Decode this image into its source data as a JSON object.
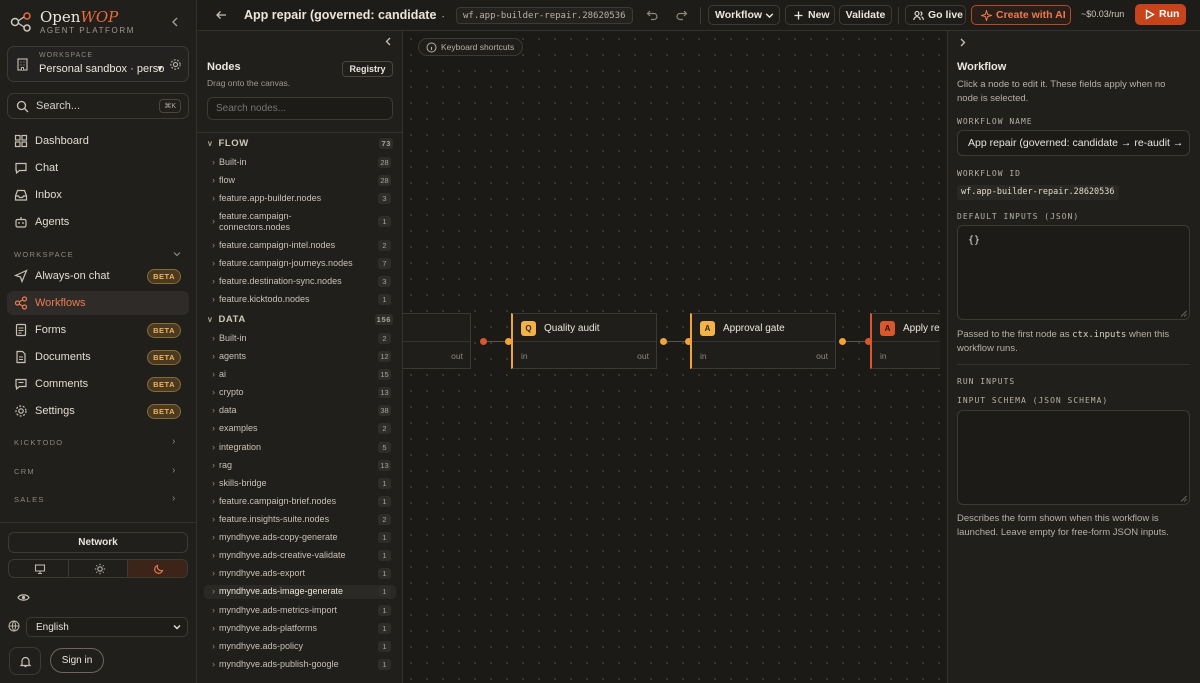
{
  "brand": {
    "name_part1": "Open",
    "name_part2": "WOP",
    "subtitle": "AGENT PLATFORM"
  },
  "workspace": {
    "label": "WORKSPACE",
    "value": "Personal sandbox · personal"
  },
  "search": {
    "placeholder": "Search...",
    "shortcut": "⌘K"
  },
  "nav_primary": [
    {
      "label": "Dashboard",
      "icon": "grid-icon"
    },
    {
      "label": "Chat",
      "icon": "chat-bubble-icon"
    },
    {
      "label": "Inbox",
      "icon": "inbox-icon"
    },
    {
      "label": "Agents",
      "icon": "robot-icon"
    }
  ],
  "workspace_section": {
    "label": "WORKSPACE"
  },
  "nav_workspace": [
    {
      "label": "Always-on chat",
      "icon": "send-icon",
      "badge": "BETA"
    },
    {
      "label": "Workflows",
      "icon": "workflow-icon",
      "badge": "",
      "active": true
    },
    {
      "label": "Forms",
      "icon": "form-icon",
      "badge": "BETA"
    },
    {
      "label": "Documents",
      "icon": "document-icon",
      "badge": "BETA"
    },
    {
      "label": "Comments",
      "icon": "comment-icon",
      "badge": "BETA"
    },
    {
      "label": "Settings",
      "icon": "gear-icon",
      "badge": "BETA"
    }
  ],
  "sections": [
    "KICKTODO",
    "CRM",
    "SALES"
  ],
  "network_label": "Network",
  "theme_options": [
    "desktop-icon",
    "sun-icon",
    "moon-icon"
  ],
  "language": "English",
  "signin_label": "Sign in",
  "topbar": {
    "title": "App repair (governed: candidate → r...",
    "workflow_id": "wf.app-builder-repair.28620536",
    "workflow_menu": "Workflow",
    "new_label": "New",
    "validate_label": "Validate",
    "golive_label": "Go live",
    "create_ai_label": "Create with AI",
    "cost": "~$0.03/run",
    "run_label": "Run"
  },
  "nodes_panel": {
    "title": "Nodes",
    "subtitle": "Drag onto the canvas.",
    "registry_label": "Registry",
    "search_placeholder": "Search nodes...",
    "categories": [
      {
        "name": "FLOW",
        "count": "73",
        "items": [
          {
            "label": "Built-in",
            "count": "28"
          },
          {
            "label": "flow",
            "count": "28"
          },
          {
            "label": "feature.app-builder.nodes",
            "count": "3"
          },
          {
            "label": "feature.campaign-connectors.nodes",
            "count": "1"
          },
          {
            "label": "feature.campaign-intel.nodes",
            "count": "2"
          },
          {
            "label": "feature.campaign-journeys.nodes",
            "count": "7"
          },
          {
            "label": "feature.destination-sync.nodes",
            "count": "3"
          },
          {
            "label": "feature.kicktodo.nodes",
            "count": "1"
          }
        ]
      },
      {
        "name": "DATA",
        "count": "156",
        "items": [
          {
            "label": "Built-in",
            "count": "2"
          },
          {
            "label": "agents",
            "count": "12"
          },
          {
            "label": "ai",
            "count": "15"
          },
          {
            "label": "crypto",
            "count": "13"
          },
          {
            "label": "data",
            "count": "38"
          },
          {
            "label": "examples",
            "count": "2"
          },
          {
            "label": "integration",
            "count": "5"
          },
          {
            "label": "rag",
            "count": "13"
          },
          {
            "label": "skills-bridge",
            "count": "1"
          },
          {
            "label": "feature.campaign-brief.nodes",
            "count": "1"
          },
          {
            "label": "feature.insights-suite.nodes",
            "count": "2"
          },
          {
            "label": "myndhyve.ads-copy-generate",
            "count": "1"
          },
          {
            "label": "myndhyve.ads-creative-validate",
            "count": "1"
          },
          {
            "label": "myndhyve.ads-export",
            "count": "1"
          },
          {
            "label": "myndhyve.ads-image-generate",
            "count": "1"
          },
          {
            "label": "myndhyve.ads-metrics-import",
            "count": "1"
          },
          {
            "label": "myndhyve.ads-platforms",
            "count": "1"
          },
          {
            "label": "myndhyve.ads-policy",
            "count": "1"
          },
          {
            "label": "myndhyve.ads-publish-google",
            "count": "1"
          }
        ]
      }
    ]
  },
  "canvas": {
    "shortcuts_label": "Keyboard shortcuts",
    "nodes": [
      {
        "label": "",
        "badge": "",
        "port_in": "",
        "port_out": "out"
      },
      {
        "label": "Quality audit",
        "badge": "Q",
        "port_in": "in",
        "port_out": "out"
      },
      {
        "label": "Approval gate",
        "badge": "A",
        "port_in": "in",
        "port_out": "out"
      },
      {
        "label": "Apply re",
        "badge": "A",
        "port_in": "in",
        "port_out": ""
      }
    ]
  },
  "inspector": {
    "title": "Workflow",
    "description": "Click a node to edit it. These fields apply when no node is selected.",
    "name_label": "WORKFLOW NAME",
    "name_value": "App repair (governed: candidate → re-audit → ",
    "id_label": "WORKFLOW ID",
    "id_value": "wf.app-builder-repair.28620536",
    "default_inputs_label": "DEFAULT INPUTS (JSON)",
    "default_inputs_value": "{}",
    "default_inputs_help_1": "Passed to the first node as ",
    "default_inputs_help_code": "ctx.inputs",
    "default_inputs_help_2": " when this workflow runs.",
    "run_inputs_label": "RUN INPUTS",
    "schema_label": "INPUT SCHEMA (JSON SCHEMA)",
    "schema_help": "Describes the form shown when this workflow is launched. Leave empty for free-form JSON inputs."
  },
  "colors": {
    "accent": "#c6431c",
    "accent_text": "#ee7a52",
    "beta": "#f0b25a",
    "node_orange": "#f0a33a",
    "node_red": "#d9572c"
  }
}
